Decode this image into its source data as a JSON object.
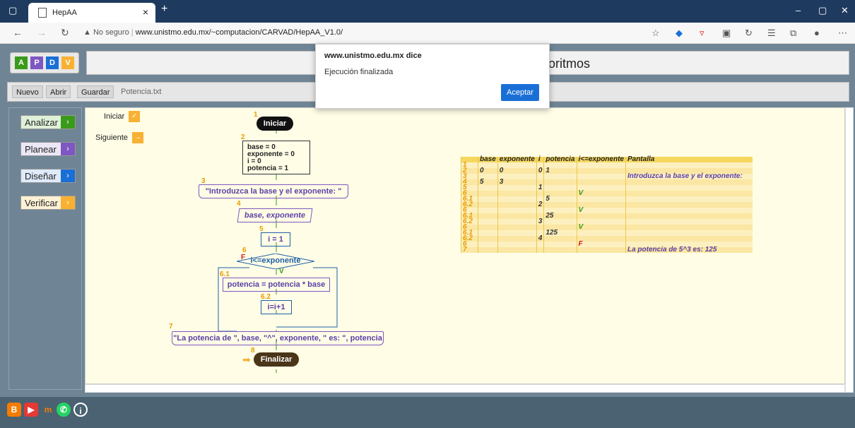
{
  "browser": {
    "tab_title": "HepAA",
    "url_warning": "No seguro",
    "url": "www.unistmo.edu.mx/~computacion/CARVAD/HepAA_V1.0/"
  },
  "app": {
    "logo_letters": [
      "A",
      "P",
      "D",
      "V"
    ],
    "title_fragment": "oritmos",
    "menu": {
      "new": "Nuevo",
      "open": "Abrir",
      "save": "Guardar",
      "filename": "Potencia.txt"
    },
    "sidebar": [
      {
        "label": "Analizar",
        "color": "#3a9a1a"
      },
      {
        "label": "Planear",
        "color": "#7e57c2"
      },
      {
        "label": "Diseñar",
        "color": "#1a6fd6"
      },
      {
        "label": "Verificar",
        "color": "#f9b133"
      }
    ],
    "controls": {
      "start": "Iniciar",
      "next": "Siguiente"
    }
  },
  "flowchart": {
    "nodes": [
      {
        "num": "1",
        "text": "Iniciar"
      },
      {
        "num": "2",
        "text": [
          "base = 0",
          "exponente = 0",
          "i = 0",
          "potencia = 1"
        ]
      },
      {
        "num": "3",
        "text": "\"Introduzca la base y el exponente: \""
      },
      {
        "num": "4",
        "text": "base, exponente"
      },
      {
        "num": "5",
        "text": "i = 1"
      },
      {
        "num": "6",
        "text": "i<=exponente",
        "false_label": "F",
        "true_label": "V"
      },
      {
        "num": "6.1",
        "text": "potencia = potencia * base"
      },
      {
        "num": "6.2",
        "text": "i=i+1"
      },
      {
        "num": "7",
        "text": "\"La potencia de \", base, \"^\", exponente, \" es: \", potencia"
      },
      {
        "num": "8",
        "text": "Finalizar"
      }
    ]
  },
  "trace_table": {
    "headers": [
      "",
      "base",
      "exponente",
      "i",
      "potencia",
      "i<=exponente",
      "Pantalla"
    ],
    "rows": [
      [
        "1",
        "",
        "",
        "",
        "",
        "",
        ""
      ],
      [
        "2",
        "0",
        "0",
        "0",
        "1",
        "",
        ""
      ],
      [
        "3",
        "",
        "",
        "",
        "",
        "",
        "Introduzca la base y el exponente:"
      ],
      [
        "4",
        "5",
        "3",
        "",
        "",
        "",
        ""
      ],
      [
        "5",
        "",
        "",
        "1",
        "",
        "",
        ""
      ],
      [
        "6",
        "",
        "",
        "",
        "",
        "V",
        ""
      ],
      [
        "6.1",
        "",
        "",
        "",
        "5",
        "",
        ""
      ],
      [
        "6.2",
        "",
        "",
        "2",
        "",
        "",
        ""
      ],
      [
        "6",
        "",
        "",
        "",
        "",
        "V",
        ""
      ],
      [
        "6.1",
        "",
        "",
        "",
        "25",
        "",
        ""
      ],
      [
        "6.2",
        "",
        "",
        "3",
        "",
        "",
        ""
      ],
      [
        "6",
        "",
        "",
        "",
        "",
        "V",
        ""
      ],
      [
        "6.1",
        "",
        "",
        "",
        "125",
        "",
        ""
      ],
      [
        "6.2",
        "",
        "",
        "4",
        "",
        "",
        ""
      ],
      [
        "6",
        "",
        "",
        "",
        "",
        "F",
        ""
      ],
      [
        "7",
        "",
        "",
        "",
        "",
        "",
        "La potencia de 5^3 es: 125"
      ]
    ]
  },
  "dialog": {
    "title": "www.unistmo.edu.mx dice",
    "message": "Ejecución finalizada",
    "ok": "Aceptar"
  }
}
